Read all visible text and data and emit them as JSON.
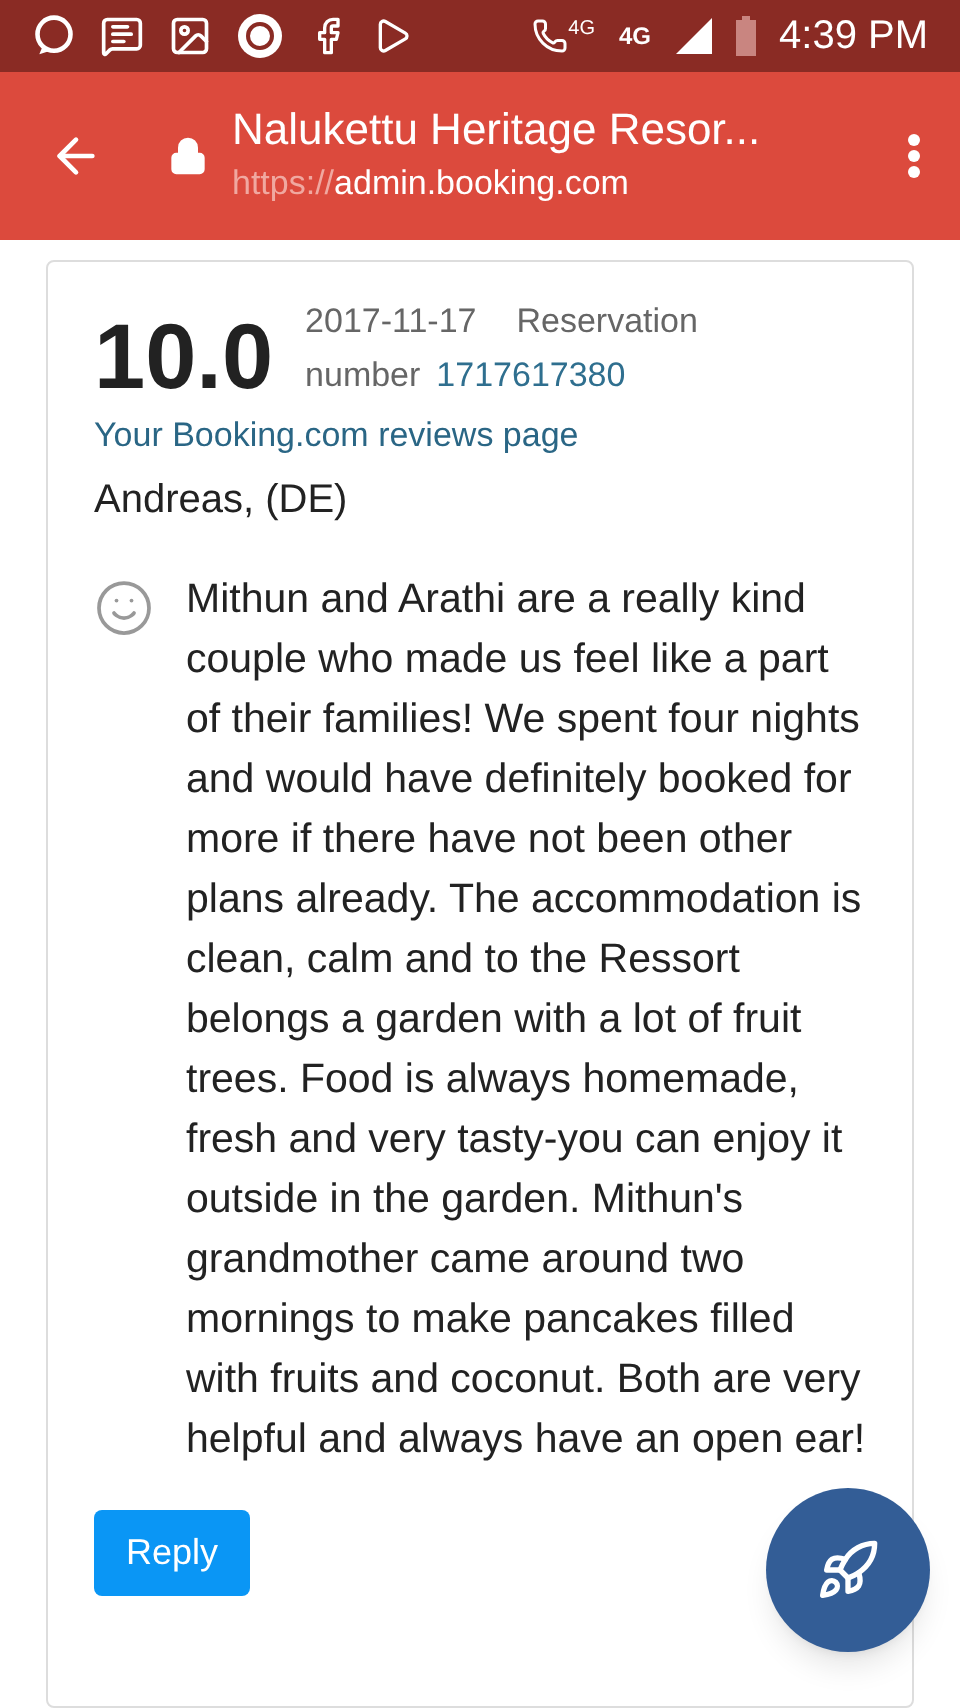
{
  "status_bar": {
    "call_network": "4G",
    "network": "4G",
    "time": "4:39 PM"
  },
  "toolbar": {
    "title": "Nalukettu Heritage Resor...",
    "url_scheme": "https://",
    "url_host": "admin.booking.com"
  },
  "review": {
    "score": "10.0",
    "date": "2017-11-17",
    "reservation_label": "Reservation number",
    "reservation_number": "1717617380",
    "reviews_link": "Your Booking.com reviews page",
    "author": "Andreas, (DE)",
    "text": "Mithun and Arathi are a really kind couple who made us feel like a part of their families! We spent four nights and would have definitely booked for more if there have not been other plans already. The accommodation is clean, calm and to the Ressort belongs a garden with a lot of fruit trees. Food is always homemade, fresh and very tasty-you can enjoy it outside in the garden. Mithun's grandmother came around two mornings to make pancakes filled with fruits and coconut. Both are very helpful and always have an open ear!",
    "reply_button": "Reply"
  }
}
